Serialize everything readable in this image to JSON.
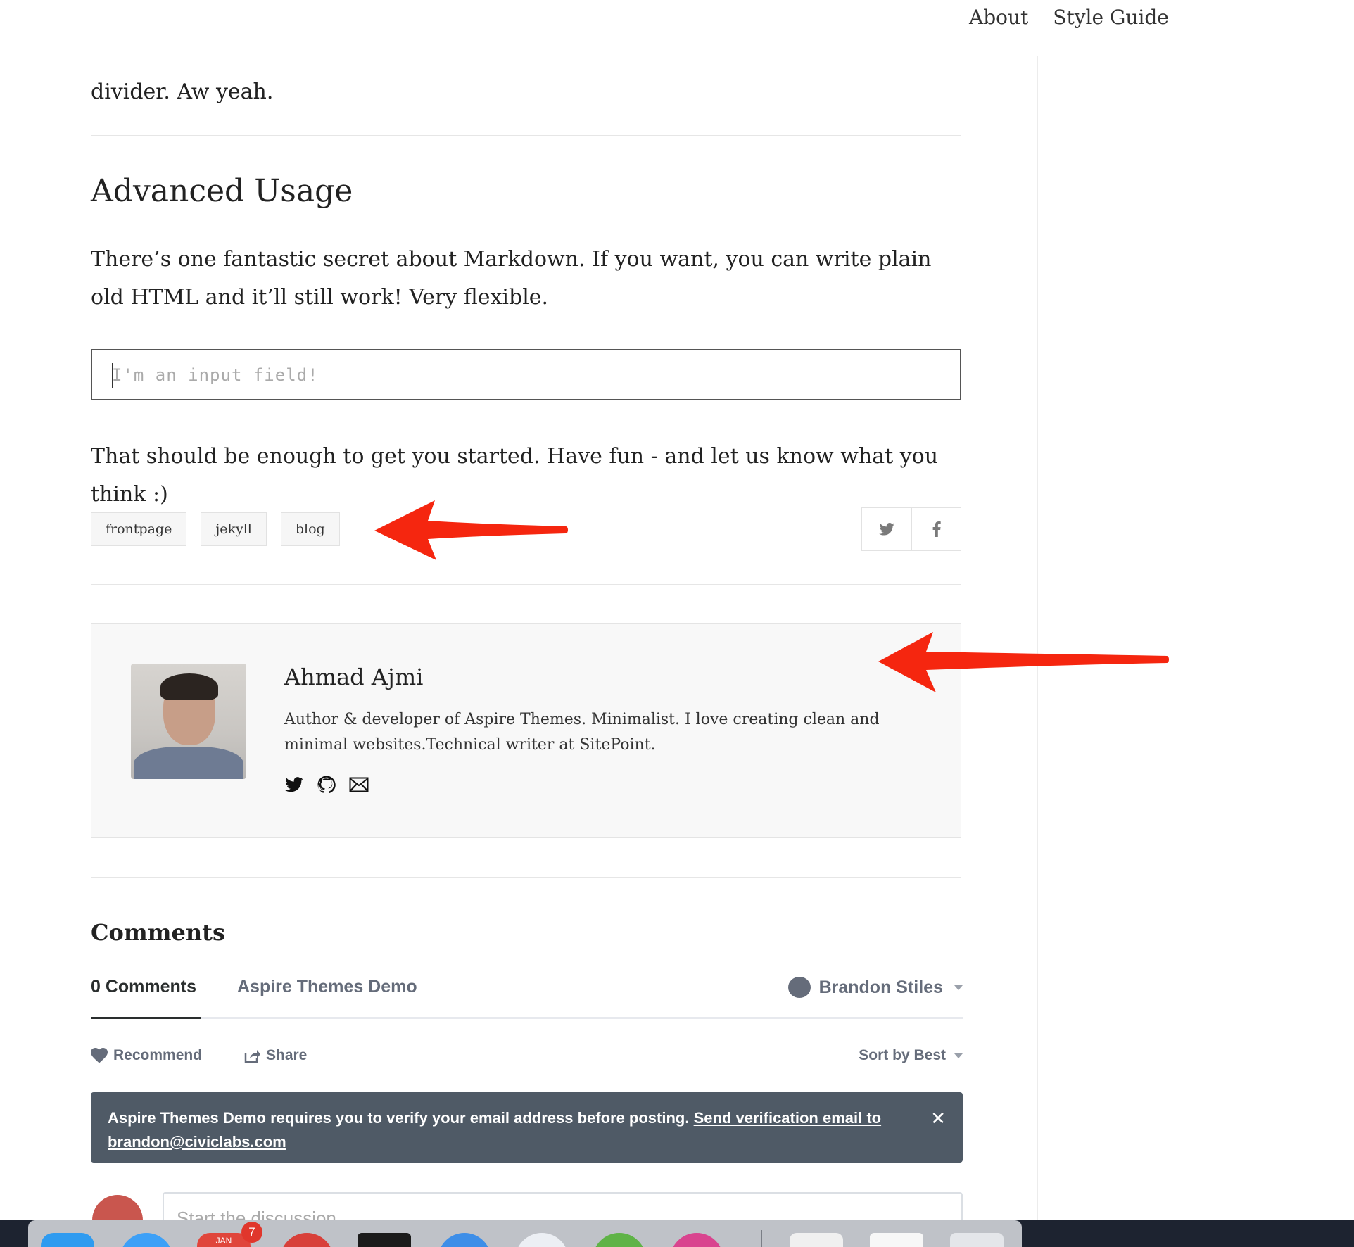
{
  "nav": {
    "items": [
      "About",
      "Style Guide"
    ]
  },
  "article": {
    "partial_line": "divider. Aw yeah.",
    "heading": "Advanced Usage",
    "paragraph1": "There’s one fantastic secret about Markdown. If you want, you can write plain old HTML and it’ll still work! Very flexible.",
    "input_placeholder": "I'm an input field!",
    "paragraph2": "That should be enough to get you started. Have fun - and let us know what you think :)",
    "tags": [
      "frontpage",
      "jekyll",
      "blog"
    ],
    "share": {
      "icons": [
        "twitter-icon",
        "facebook-icon"
      ]
    }
  },
  "author": {
    "name": "Ahmad Ajmi",
    "bio": "Author & developer of Aspire Themes. Minimalist. I love creating clean and minimal websites.Technical writer at SitePoint.",
    "social_icons": [
      "twitter-icon",
      "github-icon",
      "mail-icon"
    ]
  },
  "comments": {
    "heading": "Comments",
    "tab_count": "0 Comments",
    "tab_site": "Aspire Themes Demo",
    "user": "Brandon Stiles",
    "recommend": "Recommend",
    "share": "Share",
    "sort": "Sort by Best",
    "alert_text": "Aspire Themes Demo requires you to verify your email address before posting.",
    "alert_link": "Send verification email to brandon@civiclabs.com",
    "compose_placeholder": "Start the discussion..."
  },
  "dock": {
    "calendar_month": "JAN",
    "calendar_badge": "7"
  },
  "colors": {
    "annotation_arrow": "#f5260f",
    "alert_bg": "#4f5a66",
    "disqus_text": "#656c7a"
  }
}
